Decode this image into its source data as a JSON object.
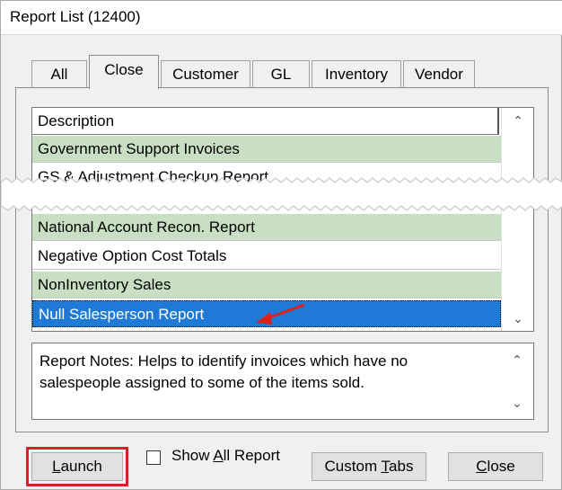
{
  "window": {
    "title": "Report List (12400)"
  },
  "tabs": [
    {
      "label": "All",
      "active": false
    },
    {
      "label": "Close",
      "active": true
    },
    {
      "label": "Customer",
      "active": false
    },
    {
      "label": "GL",
      "active": false
    },
    {
      "label": "Inventory",
      "active": false
    },
    {
      "label": "Vendor",
      "active": false
    }
  ],
  "list": {
    "header": "Description",
    "rows_top": [
      {
        "label": "Government Support Invoices",
        "color": "green"
      },
      {
        "label": "GS & Adjustment Checkup Report",
        "color": "white"
      }
    ],
    "rows_bottom": [
      {
        "label": "National Account Recon. Report",
        "color": "green"
      },
      {
        "label": "Negative Option Cost Totals",
        "color": "white"
      },
      {
        "label": "NonInventory Sales",
        "color": "green"
      },
      {
        "label": "Null Salesperson Report",
        "color": "selected"
      }
    ]
  },
  "notes": {
    "text": "Report Notes:  Helps to identify invoices which have no salespeople assigned to some of the items sold."
  },
  "buttons": {
    "launch": {
      "pre": "",
      "u": "L",
      "post": "aunch"
    },
    "show_all": {
      "pre": "Show ",
      "u": "A",
      "post": "ll Report"
    },
    "custom_tabs": {
      "pre": "Custom ",
      "u": "T",
      "post": "abs"
    },
    "close": {
      "pre": "",
      "u": "C",
      "post": "lose"
    }
  },
  "colors": {
    "green_row": "#c8dfc3",
    "selected_row": "#1e7ad6",
    "highlight_frame": "#d2232a"
  }
}
